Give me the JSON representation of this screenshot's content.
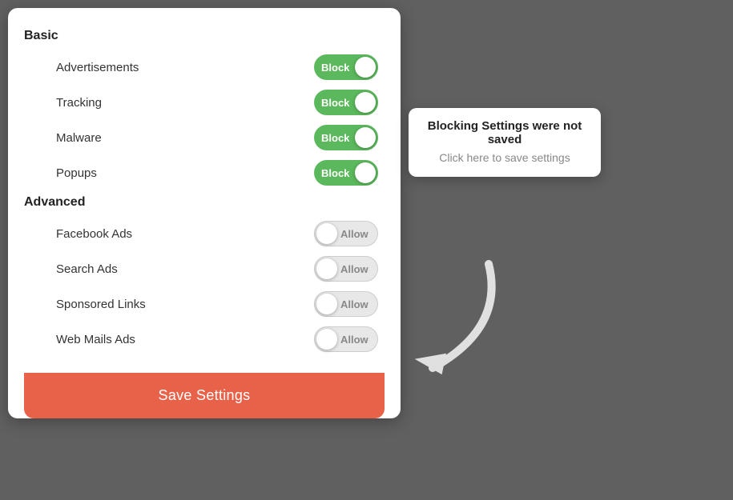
{
  "panel": {
    "basic_label": "Basic",
    "advanced_label": "Advanced",
    "items_basic": [
      {
        "label": "Advertisements",
        "state": "Block",
        "type": "block"
      },
      {
        "label": "Tracking",
        "state": "Block",
        "type": "block"
      },
      {
        "label": "Malware",
        "state": "Block",
        "type": "block"
      },
      {
        "label": "Popups",
        "state": "Block",
        "type": "block"
      }
    ],
    "items_advanced": [
      {
        "label": "Facebook Ads",
        "state": "Allow",
        "type": "allow"
      },
      {
        "label": "Search Ads",
        "state": "Allow",
        "type": "allow"
      },
      {
        "label": "Sponsored Links",
        "state": "Allow",
        "type": "allow"
      },
      {
        "label": "Web Mails Ads",
        "state": "Allow",
        "type": "allow"
      }
    ],
    "save_button_label": "Save Settings"
  },
  "notification": {
    "title": "Blocking Settings were not saved",
    "subtitle": "Click here to save settings"
  },
  "colors": {
    "block_bg": "#5cb85c",
    "allow_bg": "#e8e8e8",
    "save_btn_bg": "#e8624a"
  }
}
